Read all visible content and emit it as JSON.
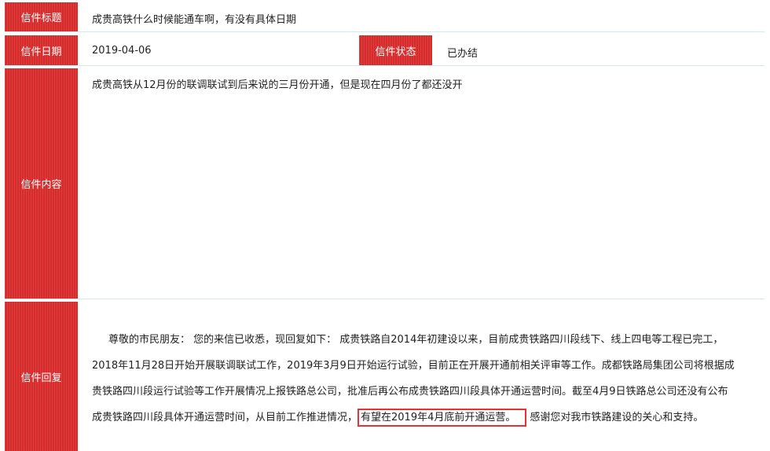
{
  "letter": {
    "title_label": "信件标题",
    "title_value": "成贵高铁什么时候能通车啊，有没有具体日期",
    "date_label": "信件日期",
    "date_value": "2019-04-06",
    "status_label": "信件状态",
    "status_value": "已办结",
    "content_label": "信件内容",
    "content_value": "成贵高铁从12月份的联调联试到后来说的三月份开通，但是现在四月份了都还没开",
    "reply_label": "信件回复",
    "reply_lines": [
      "尊敬的市民朋友：  您的来信已收悉，现回复如下：  成贵铁路自2014年初建设以来，目前成贵铁路四川段线下、线上四电等工程已完工，",
      "2018年11月28日开始开展联调联试工作，2019年3月9日开始运行试验，目前正在开展开通前相关评审等工作。成都铁路局集团公司将根据成",
      "贵铁路四川段运行试验等工作开展情况上报铁路总公司，批准后再公布成贵铁路四川段具体开通运营时间。截至4月9日铁路总公司还没有公布"
    ],
    "reply_last_before": "成贵铁路四川段具体开通运营时间，从目前工作推进情况，",
    "reply_highlight": "有望在2019年4月底前开通运营。",
    "reply_last_after": "感谢您对我市铁路建设的关心和支持。"
  },
  "colors": {
    "label_bg": "#d72b2b",
    "row_border": "#d6e8ee",
    "highlight_border": "#e53333"
  }
}
